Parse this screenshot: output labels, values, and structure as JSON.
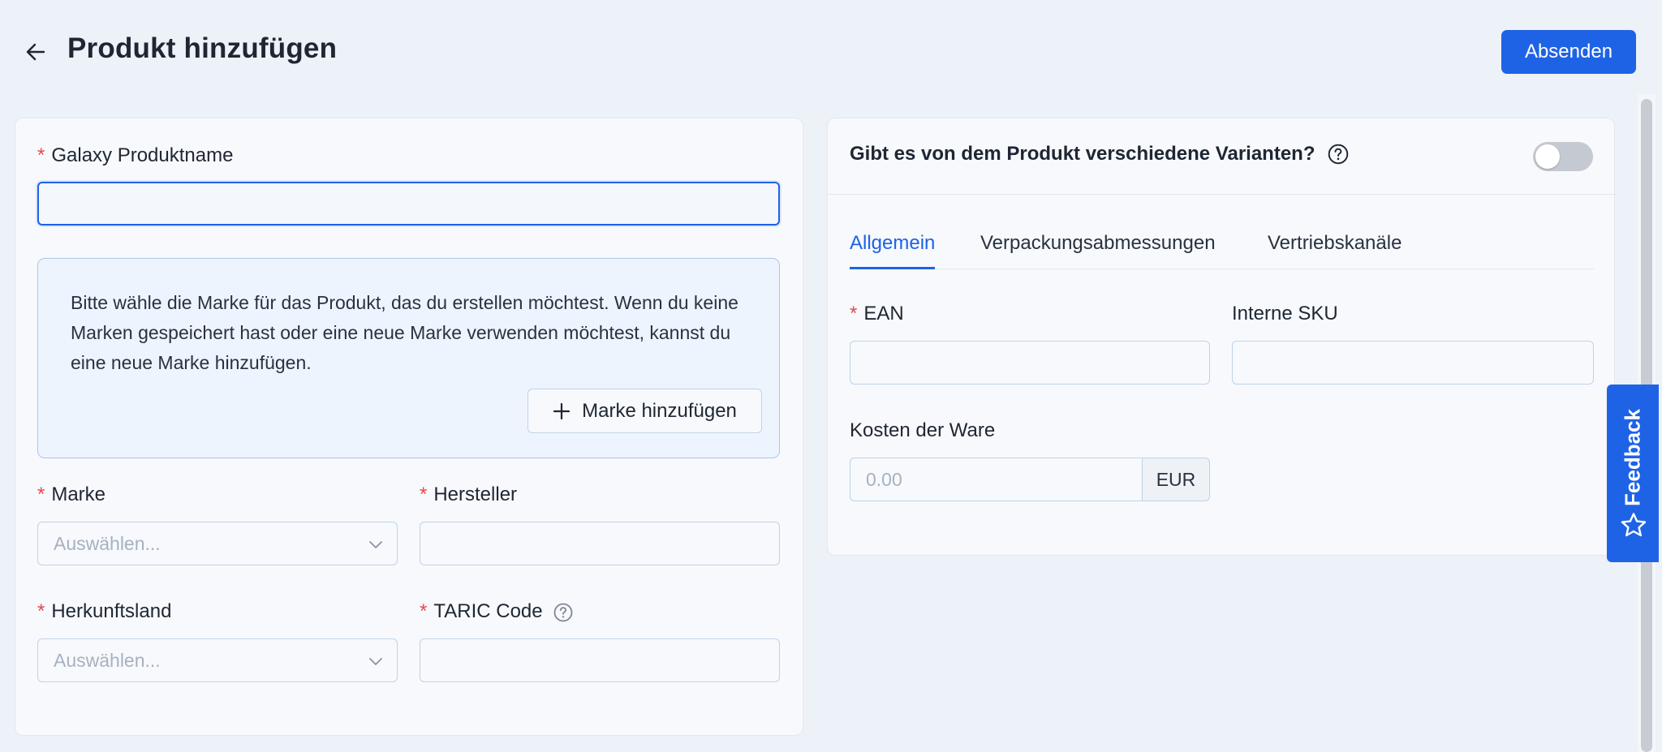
{
  "header": {
    "title": "Produkt hinzufügen",
    "submit_label": "Absenden"
  },
  "left": {
    "product_name_label": "Galaxy Produktname",
    "product_name_value": "",
    "info_text": "Bitte wähle die Marke für das Produkt, das du erstellen möchtest. Wenn du keine Marken gespeichert hast oder eine neue Marke verwenden möchtest, kannst du eine neue Marke hinzufügen.",
    "add_brand_label": "Marke hinzufügen",
    "brand_label": "Marke",
    "brand_placeholder": "Auswählen...",
    "manufacturer_label": "Hersteller",
    "manufacturer_value": "",
    "origin_label": "Herkunftsland",
    "origin_placeholder": "Auswählen...",
    "taric_label": "TARIC Code",
    "taric_value": ""
  },
  "right": {
    "variants_question": "Gibt es von dem Produkt verschiedene Varianten?",
    "variants_enabled": false,
    "tabs": [
      {
        "label": "Allgemein",
        "active": true
      },
      {
        "label": "Verpackungsabmessungen",
        "active": false
      },
      {
        "label": "Vertriebskanäle",
        "active": false
      }
    ],
    "ean_label": "EAN",
    "ean_value": "",
    "sku_label": "Interne SKU",
    "sku_value": "",
    "cost_label": "Kosten der Ware",
    "cost_placeholder": "0.00",
    "cost_currency": "EUR"
  },
  "feedback": {
    "label": "Feedback"
  },
  "colors": {
    "accent": "#1e63e6",
    "required": "#e5484d",
    "background": "#edf1f8",
    "info_box": "#eef4fd"
  },
  "icons": {
    "back": "arrow-left-icon",
    "plus": "plus-icon",
    "chevron": "chevron-down-icon",
    "help": "question-circle-icon",
    "star": "star-icon"
  }
}
